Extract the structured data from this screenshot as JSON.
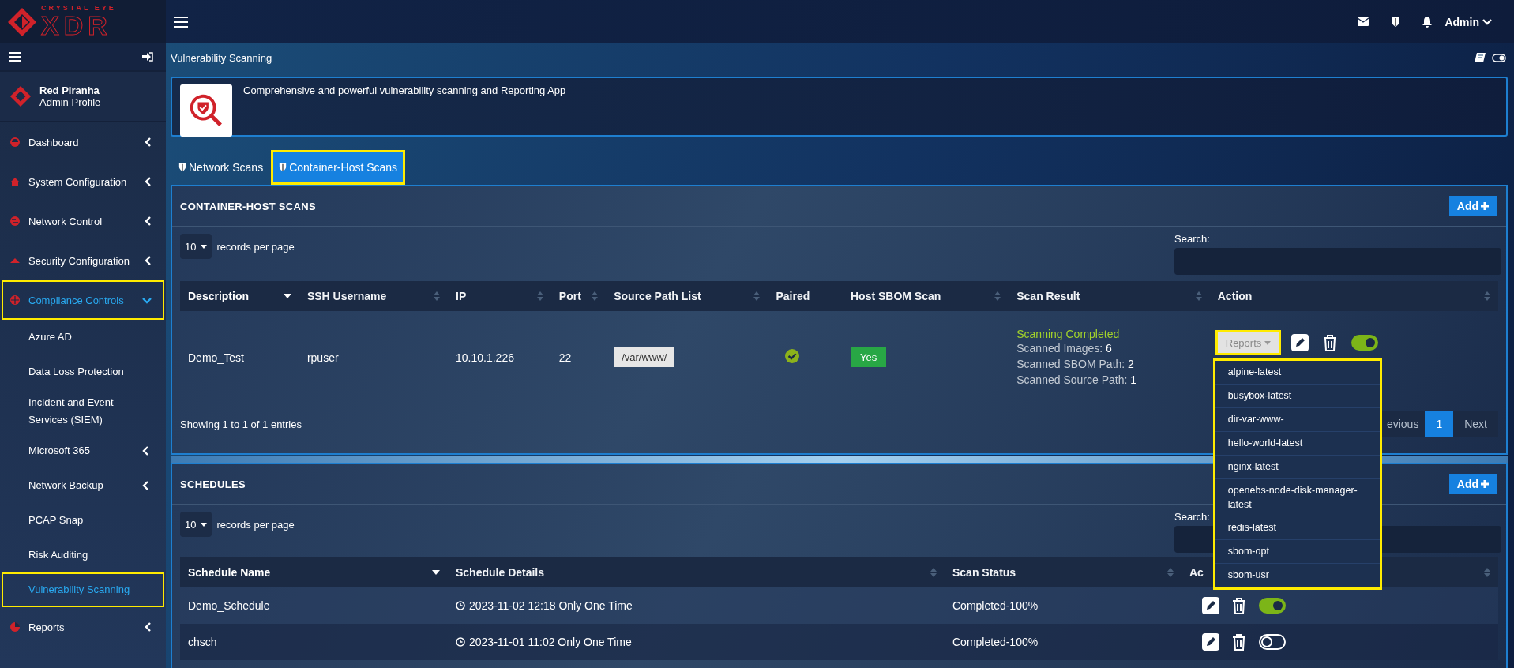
{
  "brand": {
    "tagline": "CRYSTAL EYE",
    "name": "XDR"
  },
  "topbar": {
    "user": "Admin"
  },
  "profile": {
    "name": "Red Piranha",
    "role": "Admin Profile"
  },
  "nav": [
    {
      "label": "Dashboard",
      "selected": false,
      "expanded": false,
      "highlighted": false
    },
    {
      "label": "System Configuration",
      "selected": false,
      "expanded": false,
      "highlighted": false
    },
    {
      "label": "Network Control",
      "selected": false,
      "expanded": false,
      "highlighted": false
    },
    {
      "label": "Security Configuration",
      "selected": false,
      "expanded": false,
      "highlighted": false
    },
    {
      "label": "Compliance Controls",
      "selected": true,
      "expanded": true,
      "highlighted": true,
      "children": [
        {
          "label": "Azure AD",
          "selected": false,
          "highlighted": false
        },
        {
          "label": "Data Loss Protection",
          "selected": false,
          "highlighted": false
        },
        {
          "label": "Incident and Event Services (SIEM)",
          "selected": false,
          "highlighted": false
        },
        {
          "label": "Microsoft 365",
          "selected": false,
          "expanded": false,
          "highlighted": false
        },
        {
          "label": "Network Backup",
          "selected": false,
          "expanded": false,
          "highlighted": false
        },
        {
          "label": "PCAP Snap",
          "selected": false,
          "highlighted": false
        },
        {
          "label": "Risk Auditing",
          "selected": false,
          "highlighted": false
        },
        {
          "label": "Vulnerability Scanning",
          "selected": true,
          "highlighted": true
        }
      ]
    },
    {
      "label": "Reports",
      "selected": false,
      "expanded": false,
      "highlighted": false
    }
  ],
  "page": {
    "title": "Vulnerability Scanning",
    "intro": "Comprehensive and powerful vulnerability scanning and Reporting App"
  },
  "tabs": [
    {
      "label": "Network Scans",
      "selected": false,
      "highlighted": false
    },
    {
      "label": "Container-Host Scans",
      "selected": true,
      "highlighted": true
    }
  ],
  "container_scans": {
    "title": "CONTAINER-HOST SCANS",
    "add_button": "Add",
    "page_size": "10",
    "page_size_label": "records per page",
    "search_label": "Search:",
    "columns": [
      {
        "label": "Description",
        "sortable": true,
        "sorted": true
      },
      {
        "label": "SSH Username",
        "sortable": true,
        "sorted": false
      },
      {
        "label": "IP",
        "sortable": true,
        "sorted": false
      },
      {
        "label": "Port",
        "sortable": true,
        "sorted": false
      },
      {
        "label": "Source Path List",
        "sortable": true,
        "sorted": false
      },
      {
        "label": "Paired",
        "sortable": false,
        "sorted": false
      },
      {
        "label": "Host SBOM Scan",
        "sortable": true,
        "sorted": false
      },
      {
        "label": "Scan Result",
        "sortable": true,
        "sorted": false
      },
      {
        "label": "Action",
        "sortable": true,
        "sorted": false
      }
    ],
    "rows": [
      {
        "description": "Demo_Test",
        "ssh_username": "rpuser",
        "ip": "10.10.1.226",
        "port": "22",
        "source_path": "/var/www/",
        "paired": true,
        "host_sbom": "Yes",
        "scan_status": "Scanning Completed",
        "scan_details": [
          {
            "label": "Scanned Images:",
            "value": "6"
          },
          {
            "label": "Scanned SBOM Path:",
            "value": "2"
          },
          {
            "label": "Scanned Source Path:",
            "value": "1"
          }
        ],
        "reports_button": {
          "label": "Reports",
          "highlighted": true
        },
        "enabled": true
      }
    ],
    "info": "Showing 1 to 1 of 1 entries",
    "pagination": {
      "previous": "evious",
      "pages": [
        {
          "label": "1",
          "selected": true
        }
      ],
      "next": "Next"
    }
  },
  "reports_menu": {
    "highlighted": true,
    "items": [
      "alpine-latest",
      "busybox-latest",
      "dir-var-www-",
      "hello-world-latest",
      "nginx-latest",
      "openebs-node-disk-manager-latest",
      "redis-latest",
      "sbom-opt",
      "sbom-usr"
    ]
  },
  "schedules": {
    "title": "SCHEDULES",
    "add_button": "Add",
    "page_size": "10",
    "page_size_label": "records per page",
    "search_label": "Search:",
    "columns": [
      {
        "label": "Schedule Name",
        "sortable": true,
        "sorted": true
      },
      {
        "label": "Schedule Details",
        "sortable": true,
        "sorted": false
      },
      {
        "label": "Scan Status",
        "sortable": true,
        "sorted": false
      },
      {
        "label": "Ac",
        "sortable": true,
        "sorted": false
      }
    ],
    "rows": [
      {
        "name": "Demo_Schedule",
        "details": "2023-11-02 12:18 Only One Time",
        "status": "Completed-100%",
        "enabled": true
      },
      {
        "name": "chsch",
        "details": "2023-11-01 11:02 Only One Time",
        "status": "Completed-100%",
        "enabled": false
      }
    ]
  }
}
